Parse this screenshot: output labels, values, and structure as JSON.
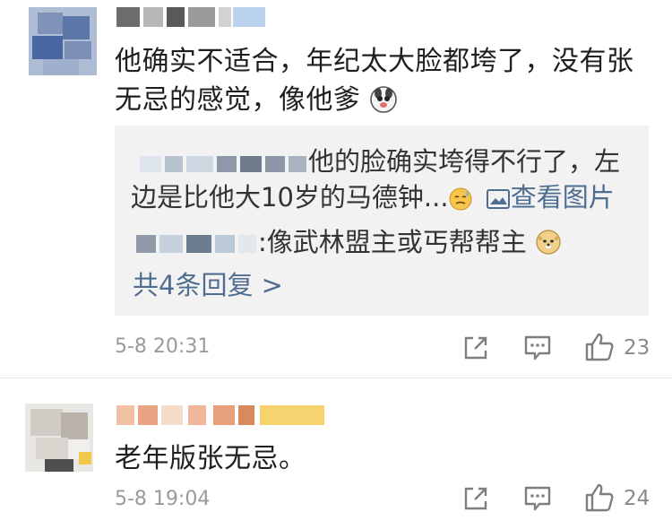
{
  "comments": [
    {
      "text_line1": "他确实不适合，年纪太大脸都垮了，没有张",
      "text_line2": "无忌的感觉，像他爹",
      "replies": [
        {
          "text_line1": "他的脸确实垮得不行了，左",
          "text_line2": "边是比他大10岁的马德钟...",
          "image_link": "查看图片"
        },
        {
          "text": ":像武林盟主或丐帮帮主"
        }
      ],
      "more_replies": "共4条回复 >",
      "time": "5-8 20:31",
      "likes": "23"
    },
    {
      "text": "老年版张无忌。",
      "time": "5-8 19:04",
      "likes": "24"
    }
  ],
  "colors": {
    "link": "#4f6d91",
    "reply_bg": "#f2f2f2",
    "meta": "#9a9a9a"
  },
  "icons": [
    "share-icon",
    "comment-icon",
    "like-icon",
    "dog-emoji",
    "sweat-emoji",
    "image-icon"
  ]
}
